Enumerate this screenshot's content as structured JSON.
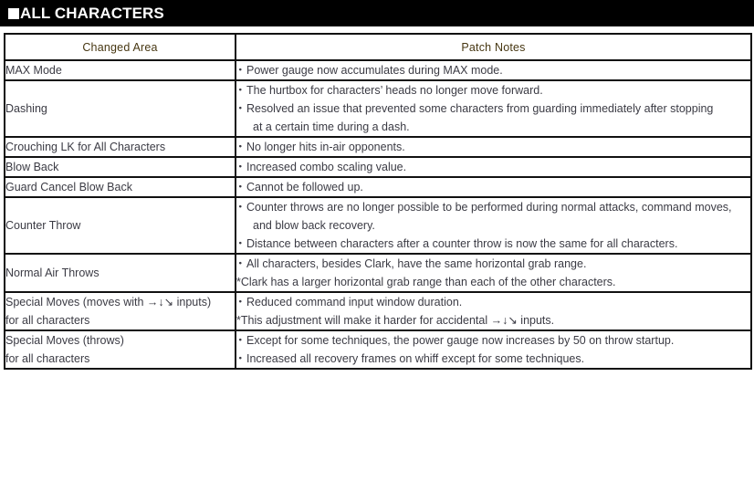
{
  "header": {
    "bullet_glyph": "square",
    "title": "ALL CHARACTERS",
    "background_color": "#000000",
    "text_color": "#ffffff"
  },
  "table": {
    "accent_color": "#fcc000",
    "border_color": "#111111",
    "text_color": "#3b3b44",
    "columns": [
      {
        "key": "changed_area",
        "label": "Changed Area"
      },
      {
        "key": "patch_notes",
        "label": "Patch Notes"
      }
    ],
    "rows": [
      {
        "area": [
          "MAX Mode"
        ],
        "notes": [
          {
            "type": "bullet",
            "text": "Power gauge now accumulates during MAX mode."
          }
        ]
      },
      {
        "area": [
          "Dashing"
        ],
        "notes": [
          {
            "type": "bullet",
            "text": "The hurtbox for characters’ heads no longer move forward."
          },
          {
            "type": "bullet",
            "text": "Resolved an issue that prevented some characters from guarding immediately after stopping"
          },
          {
            "type": "cont",
            "text": "at a certain time during a dash."
          }
        ]
      },
      {
        "area": [
          "Crouching LK for All Characters"
        ],
        "notes": [
          {
            "type": "bullet",
            "text": "No longer hits in-air opponents."
          }
        ]
      },
      {
        "area": [
          "Blow Back"
        ],
        "notes": [
          {
            "type": "bullet",
            "text": "Increased combo scaling value."
          }
        ]
      },
      {
        "area": [
          "Guard Cancel Blow Back"
        ],
        "notes": [
          {
            "type": "bullet",
            "text": "Cannot be followed up."
          }
        ]
      },
      {
        "area": [
          "Counter Throw"
        ],
        "notes": [
          {
            "type": "bullet",
            "text": "Counter throws are no longer possible to be performed during normal attacks, command moves,"
          },
          {
            "type": "cont",
            "text": "and blow back recovery."
          },
          {
            "type": "bullet",
            "text": "Distance between characters after a counter throw is now the same for all characters."
          }
        ]
      },
      {
        "area": [
          "Normal Air Throws"
        ],
        "notes": [
          {
            "type": "bullet",
            "text": "All characters, besides Clark, have the same horizontal grab range."
          },
          {
            "type": "note",
            "text": "*Clark has a larger horizontal grab range than each of the other characters."
          }
        ]
      },
      {
        "area": [
          "Special Moves (moves with →↓↘ inputs)",
          "for all characters"
        ],
        "notes": [
          {
            "type": "bullet",
            "text": "Reduced command input window duration."
          },
          {
            "type": "note",
            "text": "*This adjustment will make it harder for accidental →↓↘ inputs."
          }
        ]
      },
      {
        "area": [
          "Special Moves (throws)",
          "for all characters"
        ],
        "notes": [
          {
            "type": "bullet",
            "text": "Except for some techniques, the power gauge now increases by 50 on throw startup."
          },
          {
            "type": "bullet",
            "text": "Increased all recovery frames on whiff except for some techniques."
          }
        ]
      }
    ]
  }
}
